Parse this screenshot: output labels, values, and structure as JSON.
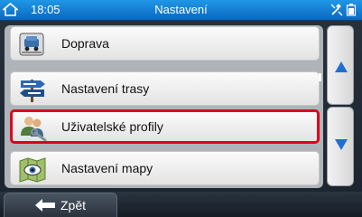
{
  "status_bar": {
    "time": "18:05",
    "title": "Nastavení"
  },
  "menu": {
    "items": [
      {
        "label": "Doprava",
        "icon": "traffic-car-icon"
      },
      {
        "label": "Nastavení trasy",
        "icon": "route-signpost-icon"
      },
      {
        "label": "Uživatelské profily",
        "icon": "user-profiles-icon",
        "selected": true
      },
      {
        "label": "Nastavení mapy",
        "icon": "map-eye-icon"
      }
    ],
    "selection_color": "#e0001c"
  },
  "navigation": {
    "back_label": "Zpět"
  },
  "colors": {
    "titlebar": "#1083d6",
    "arrow": "#1f6fd1"
  }
}
